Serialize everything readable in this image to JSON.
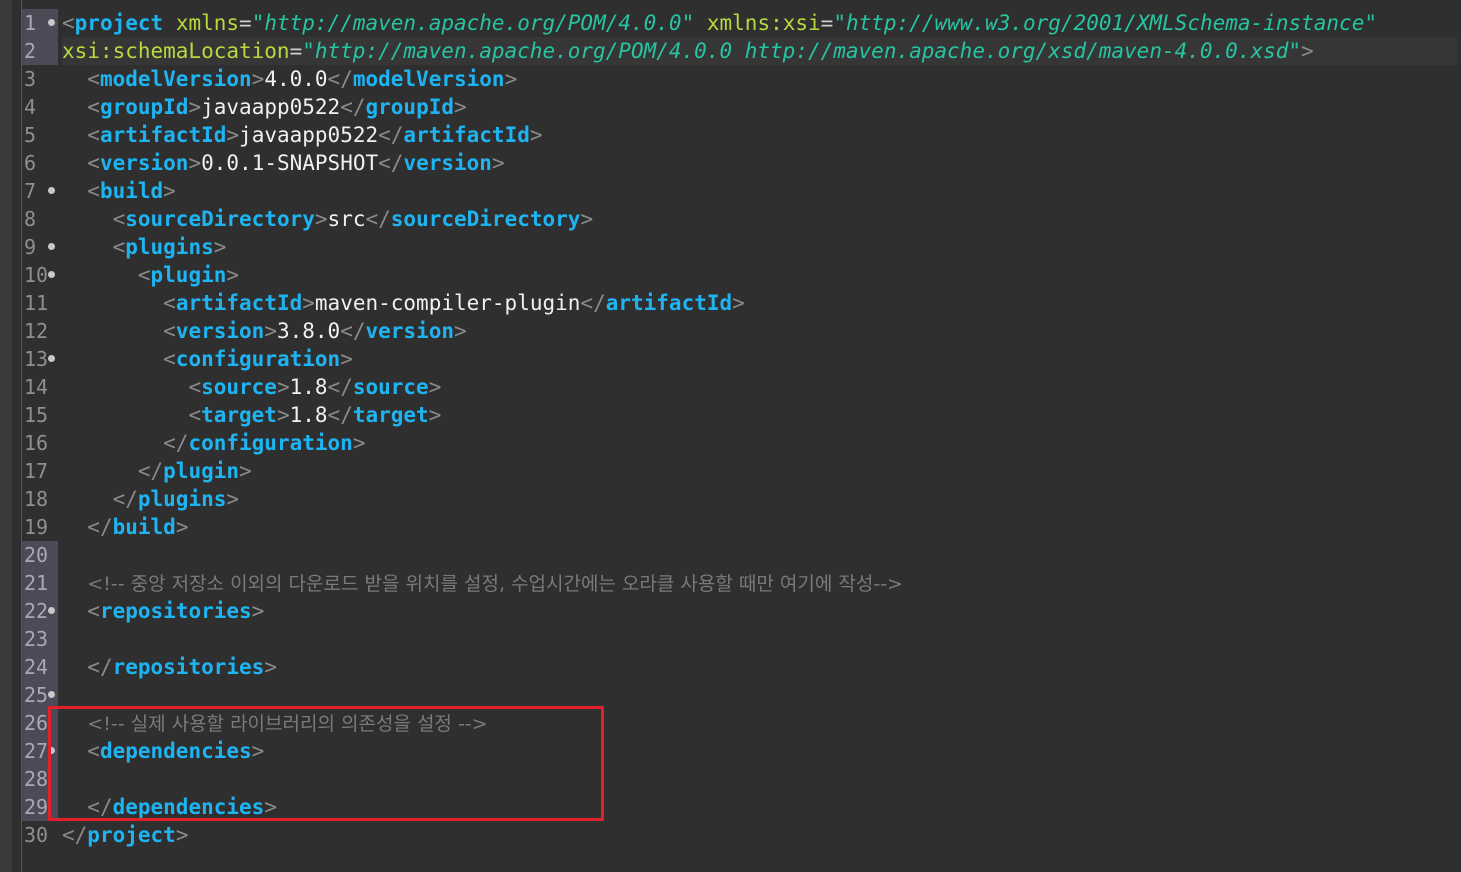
{
  "lines": [
    {
      "n": "1",
      "fold": true,
      "changed": true,
      "current": false,
      "seg": [
        [
          "brk",
          "<"
        ],
        [
          "tag",
          "project"
        ],
        [
          "txt",
          " "
        ],
        [
          "attr",
          "xmlns"
        ],
        [
          "eq",
          "="
        ],
        [
          "str",
          "\"http://maven.apache.org/POM/4.0.0\""
        ],
        [
          "txt",
          " "
        ],
        [
          "attr",
          "xmlns:xsi"
        ],
        [
          "eq",
          "="
        ],
        [
          "str",
          "\"http://www.w3.org/2001/XMLSchema-instance\""
        ]
      ]
    },
    {
      "n": "2",
      "fold": false,
      "changed": true,
      "current": true,
      "seg": [
        [
          "attr",
          "xsi:schemaLocation"
        ],
        [
          "eq",
          "="
        ],
        [
          "str",
          "\"http://maven.apache.org/POM/4.0.0 http://maven.apache.org/xsd/maven-4.0.0.xsd\""
        ],
        [
          "brk",
          ">"
        ]
      ]
    },
    {
      "n": "3",
      "fold": false,
      "changed": false,
      "current": false,
      "seg": [
        [
          "txt",
          "  "
        ],
        [
          "brk",
          "<"
        ],
        [
          "tag",
          "modelVersion"
        ],
        [
          "brk",
          ">"
        ],
        [
          "txt",
          "4.0.0"
        ],
        [
          "brk",
          "</"
        ],
        [
          "tag",
          "modelVersion"
        ],
        [
          "brk",
          ">"
        ]
      ]
    },
    {
      "n": "4",
      "fold": false,
      "changed": false,
      "current": false,
      "seg": [
        [
          "txt",
          "  "
        ],
        [
          "brk",
          "<"
        ],
        [
          "tag",
          "groupId"
        ],
        [
          "brk",
          ">"
        ],
        [
          "txt",
          "javaapp0522"
        ],
        [
          "brk",
          "</"
        ],
        [
          "tag",
          "groupId"
        ],
        [
          "brk",
          ">"
        ]
      ]
    },
    {
      "n": "5",
      "fold": false,
      "changed": false,
      "current": false,
      "seg": [
        [
          "txt",
          "  "
        ],
        [
          "brk",
          "<"
        ],
        [
          "tag",
          "artifactId"
        ],
        [
          "brk",
          ">"
        ],
        [
          "txt",
          "javaapp0522"
        ],
        [
          "brk",
          "</"
        ],
        [
          "tag",
          "artifactId"
        ],
        [
          "brk",
          ">"
        ]
      ]
    },
    {
      "n": "6",
      "fold": false,
      "changed": false,
      "current": false,
      "seg": [
        [
          "txt",
          "  "
        ],
        [
          "brk",
          "<"
        ],
        [
          "tag",
          "version"
        ],
        [
          "brk",
          ">"
        ],
        [
          "txt",
          "0.0.1-SNAPSHOT"
        ],
        [
          "brk",
          "</"
        ],
        [
          "tag",
          "version"
        ],
        [
          "brk",
          ">"
        ]
      ]
    },
    {
      "n": "7",
      "fold": true,
      "changed": false,
      "current": false,
      "seg": [
        [
          "txt",
          "  "
        ],
        [
          "brk",
          "<"
        ],
        [
          "tag",
          "build"
        ],
        [
          "brk",
          ">"
        ]
      ]
    },
    {
      "n": "8",
      "fold": false,
      "changed": false,
      "current": false,
      "seg": [
        [
          "txt",
          "    "
        ],
        [
          "brk",
          "<"
        ],
        [
          "tag",
          "sourceDirectory"
        ],
        [
          "brk",
          ">"
        ],
        [
          "txt",
          "src"
        ],
        [
          "brk",
          "</"
        ],
        [
          "tag",
          "sourceDirectory"
        ],
        [
          "brk",
          ">"
        ]
      ]
    },
    {
      "n": "9",
      "fold": true,
      "changed": false,
      "current": false,
      "seg": [
        [
          "txt",
          "    "
        ],
        [
          "brk",
          "<"
        ],
        [
          "tag",
          "plugins"
        ],
        [
          "brk",
          ">"
        ]
      ]
    },
    {
      "n": "10",
      "fold": true,
      "changed": false,
      "current": false,
      "seg": [
        [
          "txt",
          "      "
        ],
        [
          "brk",
          "<"
        ],
        [
          "tag",
          "plugin"
        ],
        [
          "brk",
          ">"
        ]
      ]
    },
    {
      "n": "11",
      "fold": false,
      "changed": false,
      "current": false,
      "seg": [
        [
          "txt",
          "        "
        ],
        [
          "brk",
          "<"
        ],
        [
          "tag",
          "artifactId"
        ],
        [
          "brk",
          ">"
        ],
        [
          "txt",
          "maven-compiler-plugin"
        ],
        [
          "brk",
          "</"
        ],
        [
          "tag",
          "artifactId"
        ],
        [
          "brk",
          ">"
        ]
      ]
    },
    {
      "n": "12",
      "fold": false,
      "changed": false,
      "current": false,
      "seg": [
        [
          "txt",
          "        "
        ],
        [
          "brk",
          "<"
        ],
        [
          "tag",
          "version"
        ],
        [
          "brk",
          ">"
        ],
        [
          "txt",
          "3.8.0"
        ],
        [
          "brk",
          "</"
        ],
        [
          "tag",
          "version"
        ],
        [
          "brk",
          ">"
        ]
      ]
    },
    {
      "n": "13",
      "fold": true,
      "changed": false,
      "current": false,
      "seg": [
        [
          "txt",
          "        "
        ],
        [
          "brk",
          "<"
        ],
        [
          "tag",
          "configuration"
        ],
        [
          "brk",
          ">"
        ]
      ]
    },
    {
      "n": "14",
      "fold": false,
      "changed": false,
      "current": false,
      "seg": [
        [
          "txt",
          "          "
        ],
        [
          "brk",
          "<"
        ],
        [
          "tag",
          "source"
        ],
        [
          "brk",
          ">"
        ],
        [
          "txt",
          "1.8"
        ],
        [
          "brk",
          "</"
        ],
        [
          "tag",
          "source"
        ],
        [
          "brk",
          ">"
        ]
      ]
    },
    {
      "n": "15",
      "fold": false,
      "changed": false,
      "current": false,
      "seg": [
        [
          "txt",
          "          "
        ],
        [
          "brk",
          "<"
        ],
        [
          "tag",
          "target"
        ],
        [
          "brk",
          ">"
        ],
        [
          "txt",
          "1.8"
        ],
        [
          "brk",
          "</"
        ],
        [
          "tag",
          "target"
        ],
        [
          "brk",
          ">"
        ]
      ]
    },
    {
      "n": "16",
      "fold": false,
      "changed": false,
      "current": false,
      "seg": [
        [
          "txt",
          "        "
        ],
        [
          "brk",
          "</"
        ],
        [
          "tag",
          "configuration"
        ],
        [
          "brk",
          ">"
        ]
      ]
    },
    {
      "n": "17",
      "fold": false,
      "changed": false,
      "current": false,
      "seg": [
        [
          "txt",
          "      "
        ],
        [
          "brk",
          "</"
        ],
        [
          "tag",
          "plugin"
        ],
        [
          "brk",
          ">"
        ]
      ]
    },
    {
      "n": "18",
      "fold": false,
      "changed": false,
      "current": false,
      "seg": [
        [
          "txt",
          "    "
        ],
        [
          "brk",
          "</"
        ],
        [
          "tag",
          "plugins"
        ],
        [
          "brk",
          ">"
        ]
      ]
    },
    {
      "n": "19",
      "fold": false,
      "changed": false,
      "current": false,
      "seg": [
        [
          "txt",
          "  "
        ],
        [
          "brk",
          "</"
        ],
        [
          "tag",
          "build"
        ],
        [
          "brk",
          ">"
        ]
      ]
    },
    {
      "n": "20",
      "fold": false,
      "changed": true,
      "current": false,
      "seg": []
    },
    {
      "n": "21",
      "fold": false,
      "changed": true,
      "current": false,
      "seg": [
        [
          "txt",
          "  "
        ],
        [
          "cmt",
          "<!-- 중앙 저장소 이외의 다운로드 받을 위치를 설정, 수업시간에는 오라클 사용할 때만 여기에 작성-->"
        ]
      ]
    },
    {
      "n": "22",
      "fold": true,
      "changed": true,
      "current": false,
      "seg": [
        [
          "txt",
          "  "
        ],
        [
          "brk",
          "<"
        ],
        [
          "tag",
          "repositories"
        ],
        [
          "brk",
          ">"
        ]
      ]
    },
    {
      "n": "23",
      "fold": false,
      "changed": true,
      "current": false,
      "seg": []
    },
    {
      "n": "24",
      "fold": false,
      "changed": true,
      "current": false,
      "seg": [
        [
          "txt",
          "  "
        ],
        [
          "brk",
          "</"
        ],
        [
          "tag",
          "repositories"
        ],
        [
          "brk",
          ">"
        ]
      ]
    },
    {
      "n": "25",
      "fold": true,
      "changed": true,
      "current": false,
      "seg": []
    },
    {
      "n": "26",
      "fold": false,
      "changed": true,
      "current": false,
      "seg": [
        [
          "txt",
          "  "
        ],
        [
          "cmt",
          "<!-- 실제 사용할 라이브러리의 의존성을 설정 -->"
        ]
      ]
    },
    {
      "n": "27",
      "fold": true,
      "changed": true,
      "current": false,
      "seg": [
        [
          "txt",
          "  "
        ],
        [
          "brk",
          "<"
        ],
        [
          "tag",
          "dependencies"
        ],
        [
          "brk",
          ">"
        ]
      ]
    },
    {
      "n": "28",
      "fold": false,
      "changed": true,
      "current": false,
      "seg": []
    },
    {
      "n": "29",
      "fold": false,
      "changed": true,
      "current": false,
      "seg": [
        [
          "txt",
          "  "
        ],
        [
          "brk",
          "</"
        ],
        [
          "tag",
          "dependencies"
        ],
        [
          "brk",
          ">"
        ]
      ]
    },
    {
      "n": "30",
      "fold": false,
      "changed": false,
      "current": false,
      "seg": [
        [
          "brk",
          "</"
        ],
        [
          "tag",
          "project"
        ],
        [
          "brk",
          ">"
        ]
      ]
    }
  ]
}
